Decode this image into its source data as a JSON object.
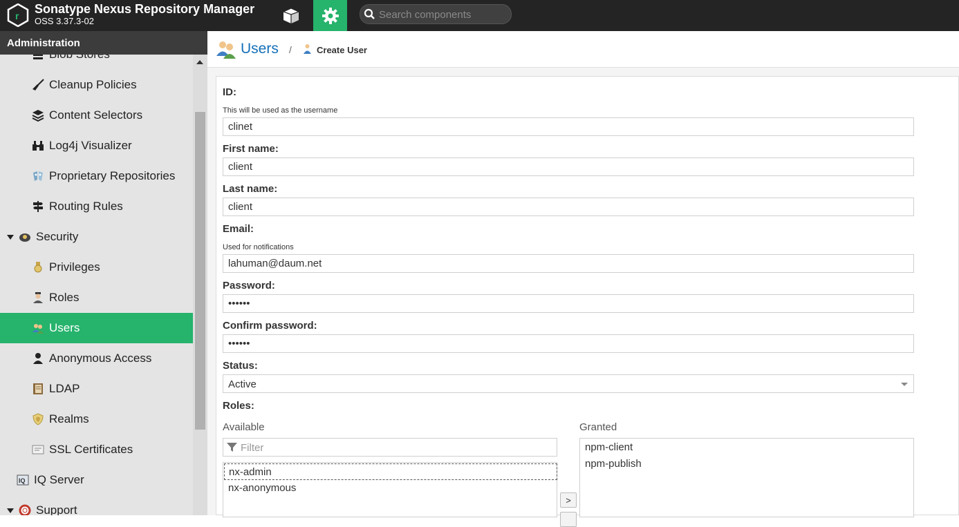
{
  "header": {
    "app_title": "Sonatype Nexus Repository Manager",
    "version": "OSS 3.37.3-02",
    "search_placeholder": "Search components",
    "accent_color": "#26b36c"
  },
  "sidebar": {
    "heading": "Administration",
    "items": [
      {
        "label": "Blob Stores",
        "icon": "database-icon"
      },
      {
        "label": "Cleanup Policies",
        "icon": "broom-icon"
      },
      {
        "label": "Content Selectors",
        "icon": "layers-icon"
      },
      {
        "label": "Log4j Visualizer",
        "icon": "binoculars-icon"
      },
      {
        "label": "Proprietary Repositories",
        "icon": "proprietary-icon"
      },
      {
        "label": "Routing Rules",
        "icon": "signpost-icon"
      },
      {
        "label": "Security",
        "icon": "security-icon",
        "expanded": true
      },
      {
        "label": "Privileges",
        "icon": "medal-icon"
      },
      {
        "label": "Roles",
        "icon": "role-icon"
      },
      {
        "label": "Users",
        "icon": "users-icon",
        "active": true
      },
      {
        "label": "Anonymous Access",
        "icon": "person-icon"
      },
      {
        "label": "LDAP",
        "icon": "book-icon"
      },
      {
        "label": "Realms",
        "icon": "shield-icon"
      },
      {
        "label": "SSL Certificates",
        "icon": "certificate-icon"
      },
      {
        "label": "IQ Server",
        "icon": "iq-icon"
      },
      {
        "label": "Support",
        "icon": "lifebuoy-icon",
        "expanded": true
      }
    ]
  },
  "breadcrumb": {
    "title": "Users",
    "separator": "/",
    "current": "Create User"
  },
  "form": {
    "id_label": "ID:",
    "id_hint": "This will be used as the username",
    "id_value": "clinet",
    "first_name_label": "First name:",
    "first_name_value": "client",
    "last_name_label": "Last name:",
    "last_name_value": "client",
    "email_label": "Email:",
    "email_hint": "Used for notifications",
    "email_value": "lahuman@daum.net",
    "password_label": "Password:",
    "password_value": "••••••",
    "confirm_label": "Confirm password:",
    "confirm_value": "••••••",
    "status_label": "Status:",
    "status_value": "Active",
    "roles_label": "Roles:",
    "available_label": "Available",
    "granted_label": "Granted",
    "filter_placeholder": "Filter",
    "available_roles": [
      "nx-admin",
      "nx-anonymous"
    ],
    "granted_roles": [
      "npm-client",
      "npm-publish"
    ],
    "move_right_glyph": ">"
  }
}
